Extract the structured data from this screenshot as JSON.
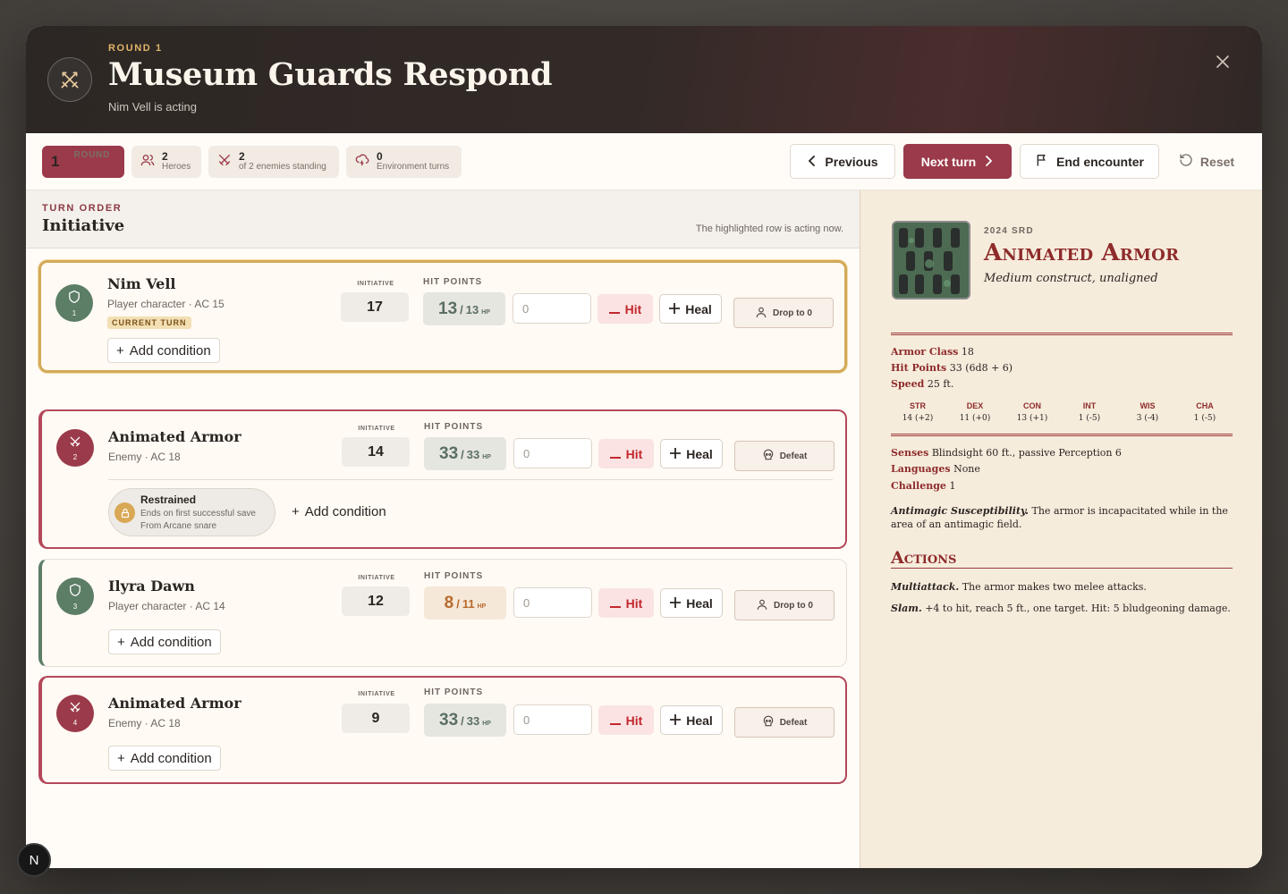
{
  "header": {
    "round_label": "ROUND 1",
    "title": "Museum Guards Respond",
    "subtitle": "Nim Vell is acting"
  },
  "stats": {
    "round_num": "1",
    "round_label": "ROUND",
    "heroes_num": "2",
    "heroes_label": "Heroes",
    "enemies_num": "2",
    "enemies_label": "of 2 enemies standing",
    "env_num": "0",
    "env_label": "Environment turns"
  },
  "toolbar": {
    "previous": "Previous",
    "next": "Next turn",
    "end": "End encounter",
    "reset": "Reset"
  },
  "turn_order": {
    "kicker": "TURN ORDER",
    "title": "Initiative",
    "note": "The highlighted row is acting now."
  },
  "labels": {
    "initiative": "INITIATIVE",
    "hit_points": "HIT POINTS",
    "hp_unit": "HP",
    "hit": "Hit",
    "heal": "Heal",
    "add_condition": "Add condition",
    "current_turn": "CURRENT TURN",
    "amount_placeholder": "0"
  },
  "combatants": [
    {
      "index": "1",
      "name": "Nim Vell",
      "meta": "Player character · AC 15",
      "initiative": "17",
      "hp_current": "13",
      "hp_max": "13",
      "action": "Drop to 0",
      "kind": "hero"
    },
    {
      "index": "2",
      "name": "Animated Armor",
      "meta": "Enemy · AC 18",
      "initiative": "14",
      "hp_current": "33",
      "hp_max": "33",
      "action": "Defeat",
      "kind": "enemy",
      "condition": {
        "name": "Restrained",
        "duration": "Ends on first successful save",
        "source": "From Arcane snare"
      }
    },
    {
      "index": "3",
      "name": "Ilyra Dawn",
      "meta": "Player character · AC 14",
      "initiative": "12",
      "hp_current": "8",
      "hp_max": "11",
      "action": "Drop to 0",
      "kind": "hero"
    },
    {
      "index": "4",
      "name": "Animated Armor",
      "meta": "Enemy · AC 18",
      "initiative": "9",
      "hp_current": "33",
      "hp_max": "33",
      "action": "Defeat",
      "kind": "enemy"
    }
  ],
  "statblock": {
    "source": "2024 SRD",
    "name": "Animated Armor",
    "type": "Medium construct, unaligned",
    "armor_class_label": "Armor Class",
    "armor_class": "18",
    "hit_points_label": "Hit Points",
    "hit_points": "33 (6d8 + 6)",
    "speed_label": "Speed",
    "speed": "25 ft.",
    "abilities": [
      {
        "key": "STR",
        "value": "14 (+2)"
      },
      {
        "key": "DEX",
        "value": "11 (+0)"
      },
      {
        "key": "CON",
        "value": "13 (+1)"
      },
      {
        "key": "INT",
        "value": "1 (-5)"
      },
      {
        "key": "WIS",
        "value": "3 (-4)"
      },
      {
        "key": "CHA",
        "value": "1 (-5)"
      }
    ],
    "senses_label": "Senses",
    "senses": "Blindsight 60 ft., passive Perception 6",
    "languages_label": "Languages",
    "languages": "None",
    "challenge_label": "Challenge",
    "challenge": "1",
    "trait_name": "Antimagic Susceptibility.",
    "trait_text": "The armor is incapacitated while in the area of an antimagic field.",
    "actions_title": "Actions",
    "action1_name": "Multiattack.",
    "action1_text": "The armor makes two melee attacks.",
    "action2_name": "Slam.",
    "action2_text": "+4 to hit, reach 5 ft., one target. Hit: 5 bludgeoning damage."
  },
  "dev_badge": "N",
  "colors": {
    "accent": "#9b3a4a",
    "hero": "#5c7d66",
    "gold": "#d3aa58",
    "statblock_red": "#8e2b2b"
  }
}
